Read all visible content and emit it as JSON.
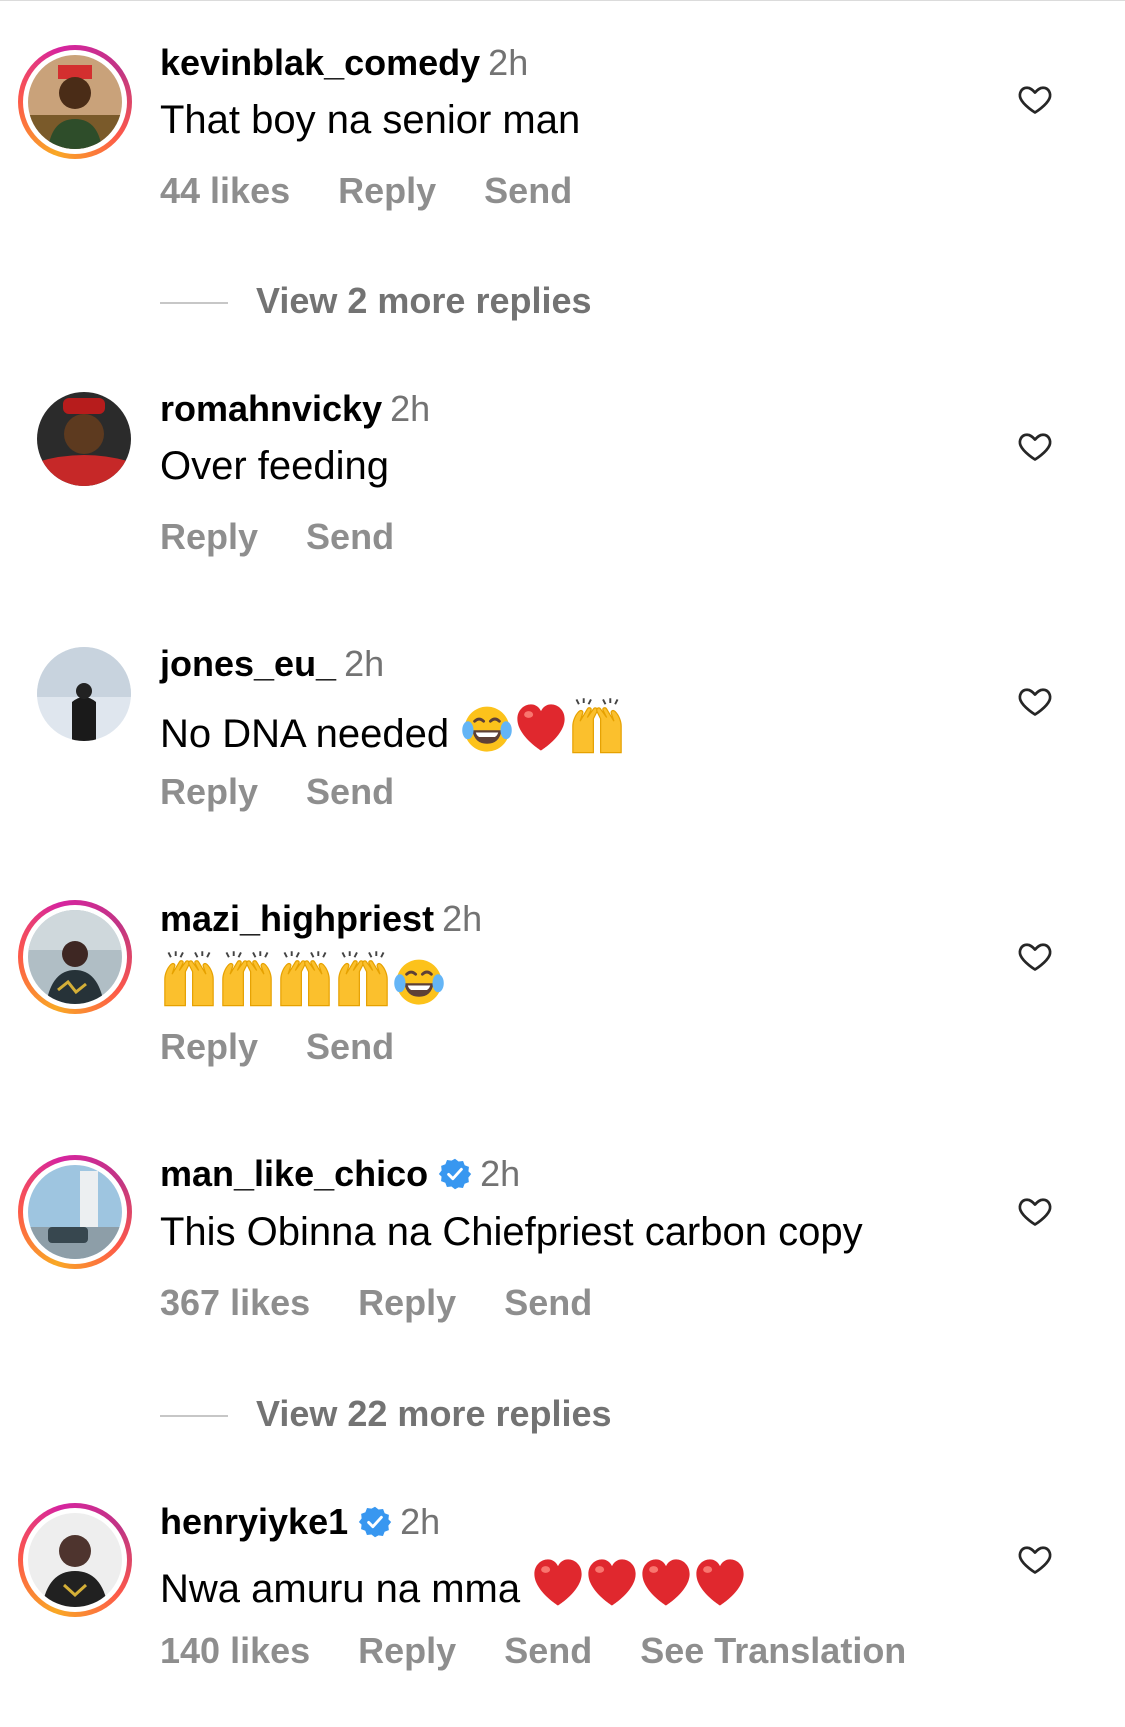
{
  "comments": [
    {
      "username": "kevinblak_comedy",
      "time": "2h",
      "text": "That boy na senior man",
      "likes": "44 likes",
      "reply": "Reply",
      "send": "Send",
      "view_more": "View 2 more replies"
    },
    {
      "username": "romahnvicky",
      "time": "2h",
      "text": "Over feeding",
      "reply": "Reply",
      "send": "Send"
    },
    {
      "username": "jones_eu_",
      "time": "2h",
      "text": "No DNA needed",
      "reply": "Reply",
      "send": "Send",
      "emoji": [
        "laughing-tears",
        "red-heart",
        "raised-hands"
      ]
    },
    {
      "username": "mazi_highpriest",
      "time": "2h",
      "text": "",
      "reply": "Reply",
      "send": "Send",
      "emoji": [
        "raised-hands",
        "raised-hands",
        "raised-hands",
        "raised-hands",
        "laughing-tears"
      ]
    },
    {
      "username": "man_like_chico",
      "time": "2h",
      "verified": true,
      "text": "This Obinna na Chiefpriest carbon copy",
      "likes": "367 likes",
      "reply": "Reply",
      "send": "Send",
      "view_more": "View 22 more replies"
    },
    {
      "username": "henryiyke1",
      "time": "2h",
      "verified": true,
      "text": "Nwa amuru na mma",
      "likes": "140 likes",
      "reply": "Reply",
      "send": "Send",
      "translate": "See Translation",
      "emoji": [
        "red-heart",
        "red-heart",
        "red-heart",
        "red-heart"
      ]
    }
  ],
  "colors": {
    "verified_blue": "#3897f0",
    "muted_text": "#8e8e8e",
    "ring_gradient": [
      "#f9a825",
      "#d6249f"
    ]
  }
}
